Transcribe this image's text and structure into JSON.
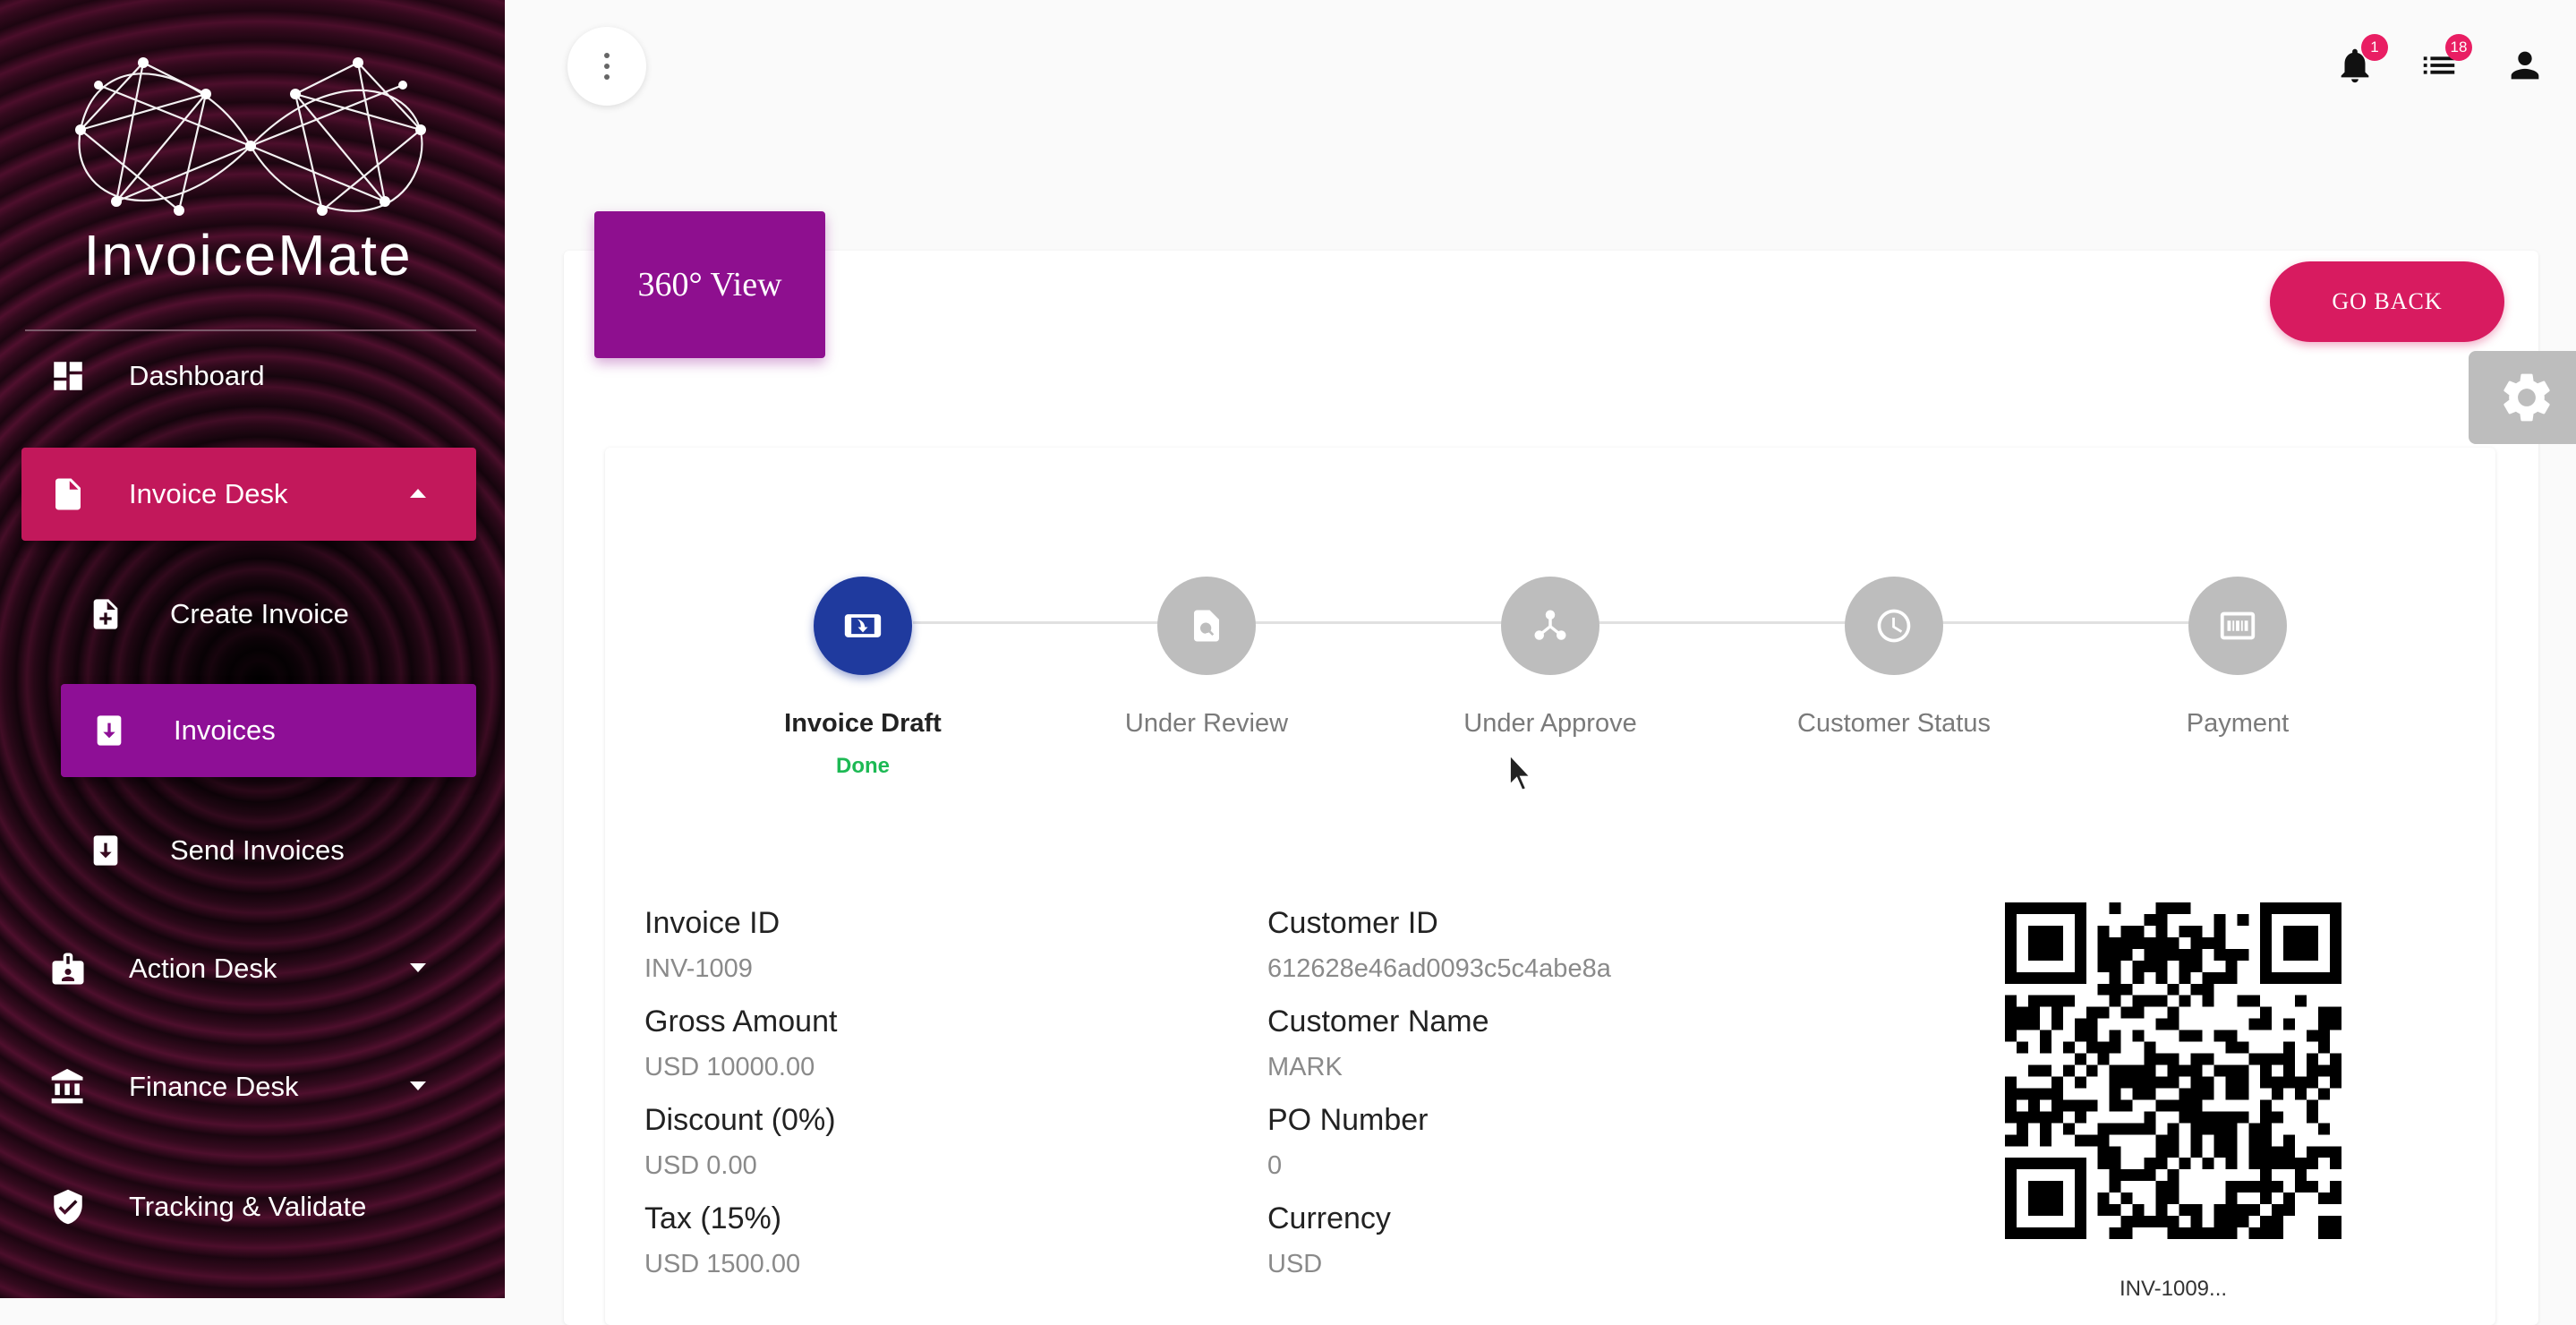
{
  "app": {
    "name": "InvoiceMate"
  },
  "sidebar": {
    "items": [
      {
        "label": "Dashboard",
        "icon": "dashboard-icon"
      },
      {
        "label": "Invoice Desk",
        "icon": "document-icon",
        "expanded": true
      },
      {
        "label": "Create Invoice",
        "icon": "add-document-icon"
      },
      {
        "label": "Invoices",
        "icon": "invoice-download-icon"
      },
      {
        "label": "Send Invoices",
        "icon": "invoice-download-icon"
      },
      {
        "label": "Action Desk",
        "icon": "badge-person-icon"
      },
      {
        "label": "Finance Desk",
        "icon": "bank-icon"
      },
      {
        "label": "Tracking & Validate",
        "icon": "shield-check-icon"
      }
    ]
  },
  "topbar": {
    "notifications_count": "1",
    "list_count": "18"
  },
  "page": {
    "header_title": "360° View",
    "go_back_label": "GO BACK"
  },
  "stepper": {
    "steps": [
      {
        "label": "Invoice Draft",
        "status": "Done",
        "icon": "mobile-download-icon"
      },
      {
        "label": "Under Review",
        "status": "",
        "icon": "document-search-icon"
      },
      {
        "label": "Under Approve",
        "status": "",
        "icon": "hub-icon"
      },
      {
        "label": "Customer Status",
        "status": "",
        "icon": "clock-icon"
      },
      {
        "label": "Payment",
        "status": "",
        "icon": "payment-icon"
      }
    ]
  },
  "details": {
    "invoice_id_label": "Invoice ID",
    "invoice_id_value": "INV-1009",
    "gross_amount_label": "Gross Amount",
    "gross_amount_value": "USD 10000.00",
    "discount_label": "Discount (0%)",
    "discount_value": "USD 0.00",
    "tax_label": "Tax (15%)",
    "tax_value": "USD 1500.00",
    "customer_id_label": "Customer ID",
    "customer_id_value": "612628e46ad0093c5c4abe8a",
    "customer_name_label": "Customer Name",
    "customer_name_value": "MARK",
    "po_number_label": "PO Number",
    "po_number_value": "0",
    "currency_label": "Currency",
    "currency_value": "USD"
  },
  "qr": {
    "caption": "INV-1009..."
  },
  "colors": {
    "brand_pink": "#d81b60",
    "brand_purple": "#8e0f8f",
    "step_active": "#1f3a9e",
    "done_green": "#1db954"
  }
}
